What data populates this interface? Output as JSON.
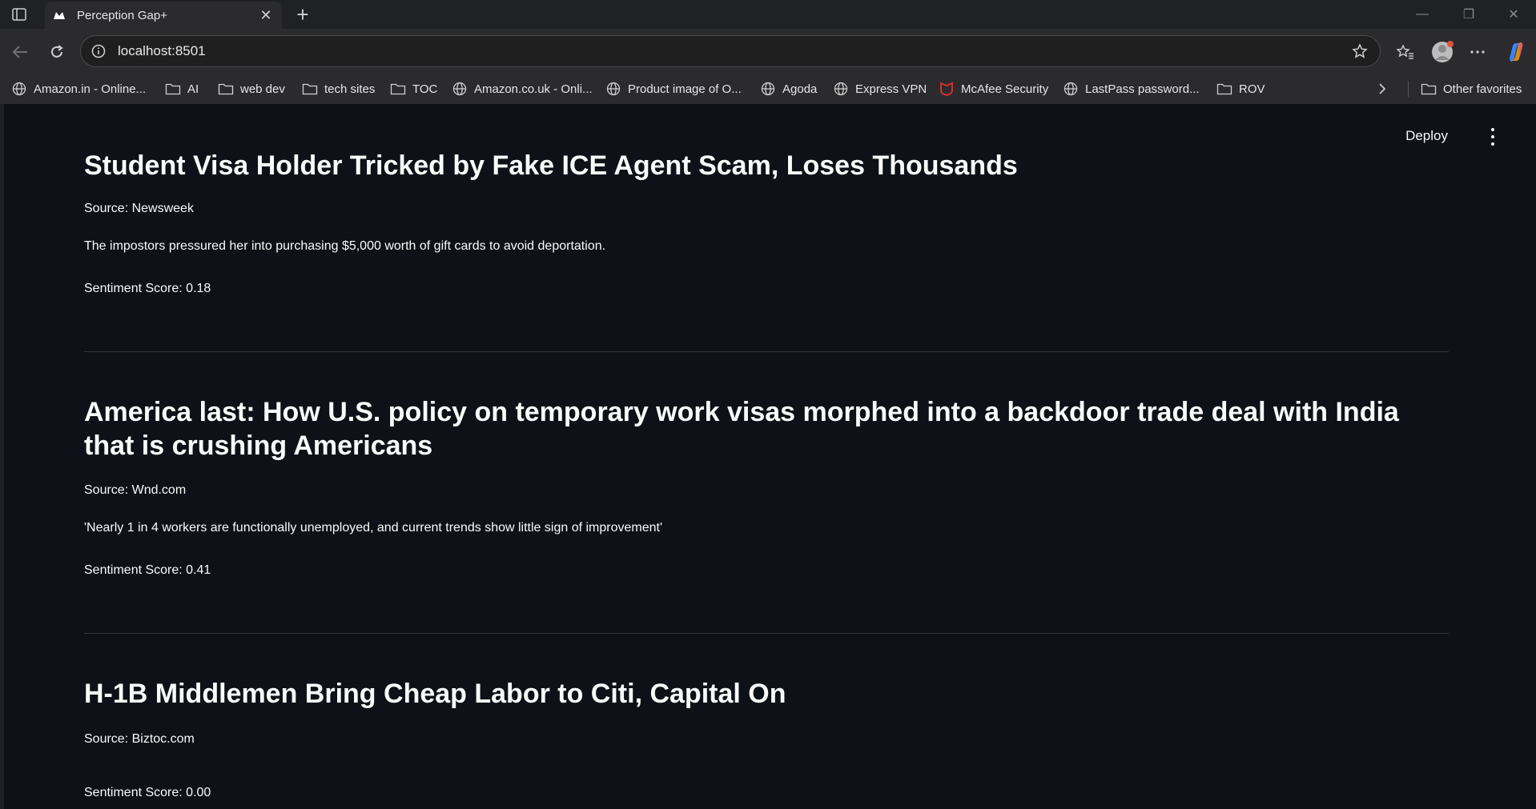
{
  "browser": {
    "tab_title": "Perception Gap+",
    "url": "localhost:8501",
    "bookmarks": [
      {
        "label": "Amazon.in - Online...",
        "icon": "globe-icon"
      },
      {
        "label": "AI",
        "icon": "folder-icon"
      },
      {
        "label": "web dev",
        "icon": "folder-icon"
      },
      {
        "label": "tech sites",
        "icon": "folder-icon"
      },
      {
        "label": "TOC",
        "icon": "folder-icon"
      },
      {
        "label": "Amazon.co.uk - Onli...",
        "icon": "globe-icon"
      },
      {
        "label": "Product image of O...",
        "icon": "globe-icon"
      },
      {
        "label": "Agoda",
        "icon": "globe-icon"
      },
      {
        "label": "Express VPN",
        "icon": "globe-icon"
      },
      {
        "label": "McAfee Security",
        "icon": "mcafee-icon"
      },
      {
        "label": "LastPass password...",
        "icon": "globe-icon"
      },
      {
        "label": "ROV",
        "icon": "folder-icon"
      }
    ],
    "other_favorites": "Other favorites"
  },
  "app": {
    "deploy_label": "Deploy",
    "articles": [
      {
        "title": "Student Visa Holder Tricked by Fake ICE Agent Scam, Loses Thousands",
        "source": "Source: Newsweek",
        "description": "The impostors pressured her into purchasing $5,000 worth of gift cards to avoid deportation.",
        "score": "Sentiment Score: 0.18"
      },
      {
        "title": "America last: How U.S. policy on temporary work visas morphed into a backdoor trade deal with India that is crushing Americans",
        "source": "Source: Wnd.com",
        "description": "'Nearly 1 in 4 workers are functionally unemployed, and current trends show little sign of improvement'",
        "score": "Sentiment Score: 0.41"
      },
      {
        "title": "H-1B Middlemen Bring Cheap Labor to Citi, Capital On",
        "source": "Source: Biztoc.com",
        "description": "",
        "score": "Sentiment Score: 0.00"
      }
    ]
  },
  "colors": {
    "app_background": "#0e1117",
    "chrome_background": "#2b2b2d",
    "text": "#fafafa",
    "muted_text": "#8b8f99",
    "divider": "#31333f"
  }
}
